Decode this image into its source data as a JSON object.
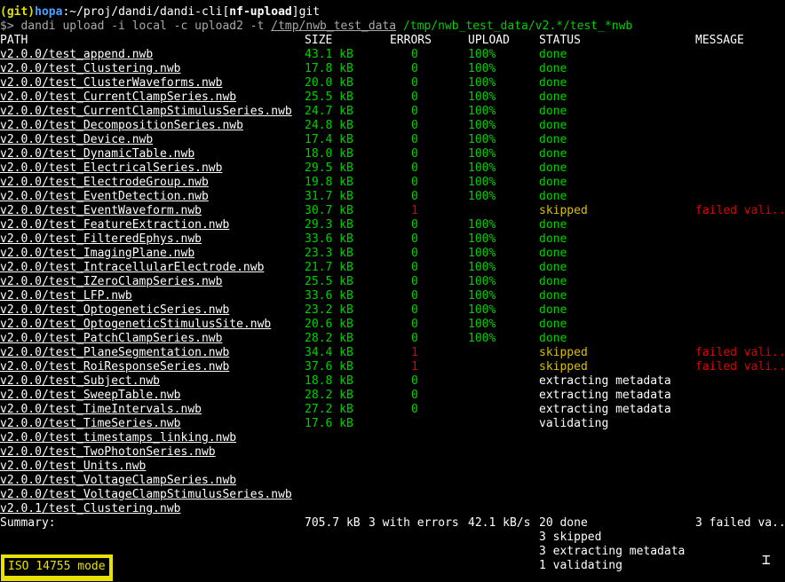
{
  "prompt": {
    "git": "(git)",
    "host": "hopa",
    "cwd": ":~/proj/dandi/dandi-cli[",
    "branch": "nf-upload",
    "tail": "]git",
    "dollar": "$> ",
    "cmd": "dandi upload -i local -c upload2 -t ",
    "arg1": "/tmp/nwb_test_data",
    "arg2": " /tmp/nwb_test_data/v2.*/test_*nwb"
  },
  "header": {
    "path": "PATH",
    "size": "SIZE",
    "errors": "ERRORS",
    "upload": "UPLOAD",
    "status": "STATUS",
    "message": "MESSAGE"
  },
  "rows": [
    {
      "path": "v2.0.0/test_append.nwb",
      "size": "43.1 kB",
      "errors": "0",
      "upload": "100%",
      "status": "done",
      "message": ""
    },
    {
      "path": "v2.0.0/test_Clustering.nwb",
      "size": "17.8 kB",
      "errors": "0",
      "upload": "100%",
      "status": "done",
      "message": ""
    },
    {
      "path": "v2.0.0/test_ClusterWaveforms.nwb",
      "size": "20.0 kB",
      "errors": "0",
      "upload": "100%",
      "status": "done",
      "message": ""
    },
    {
      "path": "v2.0.0/test_CurrentClampSeries.nwb",
      "size": "25.5 kB",
      "errors": "0",
      "upload": "100%",
      "status": "done",
      "message": ""
    },
    {
      "path": "v2.0.0/test_CurrentClampStimulusSeries.nwb",
      "size": "24.7 kB",
      "errors": "0",
      "upload": "100%",
      "status": "done",
      "message": ""
    },
    {
      "path": "v2.0.0/test_DecompositionSeries.nwb",
      "size": "24.8 kB",
      "errors": "0",
      "upload": "100%",
      "status": "done",
      "message": ""
    },
    {
      "path": "v2.0.0/test_Device.nwb",
      "size": "17.4 kB",
      "errors": "0",
      "upload": "100%",
      "status": "done",
      "message": ""
    },
    {
      "path": "v2.0.0/test_DynamicTable.nwb",
      "size": "18.0 kB",
      "errors": "0",
      "upload": "100%",
      "status": "done",
      "message": ""
    },
    {
      "path": "v2.0.0/test_ElectricalSeries.nwb",
      "size": "29.5 kB",
      "errors": "0",
      "upload": "100%",
      "status": "done",
      "message": ""
    },
    {
      "path": "v2.0.0/test_ElectrodeGroup.nwb",
      "size": "19.8 kB",
      "errors": "0",
      "upload": "100%",
      "status": "done",
      "message": ""
    },
    {
      "path": "v2.0.0/test_EventDetection.nwb",
      "size": "31.7 kB",
      "errors": "0",
      "upload": "100%",
      "status": "done",
      "message": ""
    },
    {
      "path": "v2.0.0/test_EventWaveform.nwb",
      "size": "30.7 kB",
      "errors": "1",
      "upload": "",
      "status": "skipped",
      "message": "failed vali..."
    },
    {
      "path": "v2.0.0/test_FeatureExtraction.nwb",
      "size": "29.3 kB",
      "errors": "0",
      "upload": "100%",
      "status": "done",
      "message": ""
    },
    {
      "path": "v2.0.0/test_FilteredEphys.nwb",
      "size": "33.6 kB",
      "errors": "0",
      "upload": "100%",
      "status": "done",
      "message": ""
    },
    {
      "path": "v2.0.0/test_ImagingPlane.nwb",
      "size": "23.3 kB",
      "errors": "0",
      "upload": "100%",
      "status": "done",
      "message": ""
    },
    {
      "path": "v2.0.0/test_IntracellularElectrode.nwb",
      "size": "21.7 kB",
      "errors": "0",
      "upload": "100%",
      "status": "done",
      "message": ""
    },
    {
      "path": "v2.0.0/test_IZeroClampSeries.nwb",
      "size": "25.5 kB",
      "errors": "0",
      "upload": "100%",
      "status": "done",
      "message": ""
    },
    {
      "path": "v2.0.0/test_LFP.nwb",
      "size": "33.6 kB",
      "errors": "0",
      "upload": "100%",
      "status": "done",
      "message": ""
    },
    {
      "path": "v2.0.0/test_OptogeneticSeries.nwb",
      "size": "23.2 kB",
      "errors": "0",
      "upload": "100%",
      "status": "done",
      "message": ""
    },
    {
      "path": "v2.0.0/test_OptogeneticStimulusSite.nwb",
      "size": "20.6 kB",
      "errors": "0",
      "upload": "100%",
      "status": "done",
      "message": ""
    },
    {
      "path": "v2.0.0/test_PatchClampSeries.nwb",
      "size": "28.2 kB",
      "errors": "0",
      "upload": "100%",
      "status": "done",
      "message": ""
    },
    {
      "path": "v2.0.0/test_PlaneSegmentation.nwb",
      "size": "34.4 kB",
      "errors": "1",
      "upload": "",
      "status": "skipped",
      "message": "failed vali..."
    },
    {
      "path": "v2.0.0/test_RoiResponseSeries.nwb",
      "size": "37.6 kB",
      "errors": "1",
      "upload": "",
      "status": "skipped",
      "message": "failed vali..."
    },
    {
      "path": "v2.0.0/test_Subject.nwb",
      "size": "18.8 kB",
      "errors": "0",
      "upload": "",
      "status": "extracting metadata",
      "message": ""
    },
    {
      "path": "v2.0.0/test_SweepTable.nwb",
      "size": "28.2 kB",
      "errors": "0",
      "upload": "",
      "status": "extracting metadata",
      "message": ""
    },
    {
      "path": "v2.0.0/test_TimeIntervals.nwb",
      "size": "27.2 kB",
      "errors": "0",
      "upload": "",
      "status": "extracting metadata",
      "message": ""
    },
    {
      "path": "v2.0.0/test_TimeSeries.nwb",
      "size": "17.6 kB",
      "errors": "",
      "upload": "",
      "status": "validating",
      "message": ""
    },
    {
      "path": "v2.0.0/test_timestamps_linking.nwb",
      "size": "",
      "errors": "",
      "upload": "",
      "status": "",
      "message": ""
    },
    {
      "path": "v2.0.0/test_TwoPhotonSeries.nwb",
      "size": "",
      "errors": "",
      "upload": "",
      "status": "",
      "message": ""
    },
    {
      "path": "v2.0.0/test_Units.nwb",
      "size": "",
      "errors": "",
      "upload": "",
      "status": "",
      "message": ""
    },
    {
      "path": "v2.0.0/test_VoltageClampSeries.nwb",
      "size": "",
      "errors": "",
      "upload": "",
      "status": "",
      "message": ""
    },
    {
      "path": "v2.0.0/test_VoltageClampStimulusSeries.nwb",
      "size": "",
      "errors": "",
      "upload": "",
      "status": "",
      "message": ""
    },
    {
      "path": "v2.0.1/test_Clustering.nwb",
      "size": "",
      "errors": "",
      "upload": "",
      "status": "",
      "message": ""
    }
  ],
  "summary": {
    "label": "Summary:",
    "size": "705.7 kB",
    "errors": "3 with errors",
    "upload": "42.1 kB/s",
    "status_lines": [
      "20 done",
      "3 skipped",
      "3 extracting metadata",
      "1 validating"
    ],
    "message": "3 failed va..."
  },
  "mode_indicator": "ISO 14755 mode",
  "colors": {
    "done": "#00d000",
    "skipped": "#d8c000",
    "error": "#e00000",
    "branch_host": "#4aa0ff",
    "mode": "#e8e000"
  },
  "icons": {
    "cursor": "text-cursor-icon"
  }
}
